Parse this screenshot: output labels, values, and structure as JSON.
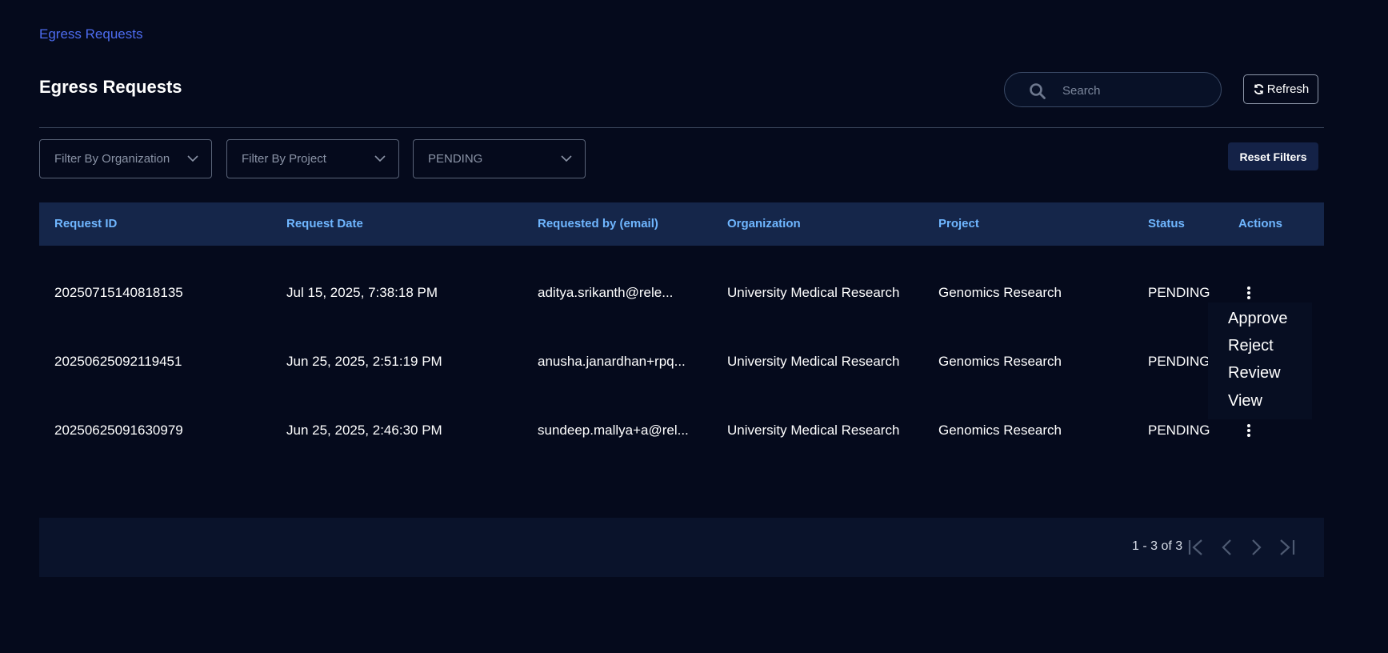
{
  "breadcrumb": {
    "label": "Egress Requests"
  },
  "page": {
    "title": "Egress Requests"
  },
  "search": {
    "placeholder": "Search",
    "value": ""
  },
  "toolbar": {
    "refresh_label": "Refresh",
    "reset_filters_label": "Reset Filters"
  },
  "filters": {
    "organization": "Filter By Organization",
    "project": "Filter By Project",
    "status": "PENDING"
  },
  "table": {
    "columns": [
      "Request ID",
      "Request Date",
      "Requested by (email)",
      "Organization",
      "Project",
      "Status",
      "Actions"
    ],
    "rows": [
      {
        "id": "20250715140818135",
        "date": "Jul 15, 2025, 7:38:18 PM",
        "email": "aditya.srikanth@rele...",
        "organization": "University Medical Research",
        "project": "Genomics Research",
        "status": "PENDING"
      },
      {
        "id": "20250625092119451",
        "date": "Jun 25, 2025, 2:51:19 PM",
        "email": "anusha.janardhan+rpq...",
        "organization": "University Medical Research",
        "project": "Genomics Research",
        "status": "PENDING"
      },
      {
        "id": "20250625091630979",
        "date": "Jun 25, 2025, 2:46:30 PM",
        "email": "sundeep.mallya+a@rel...",
        "organization": "University Medical Research",
        "project": "Genomics Research",
        "status": "PENDING"
      }
    ]
  },
  "actions_menu": {
    "items": [
      "Approve",
      "Reject",
      "Review",
      "View"
    ]
  },
  "pagination": {
    "info": "1 - 3 of 3"
  },
  "icons": {
    "search": "search-icon",
    "refresh": "refresh-icon",
    "dropdown": "chevron-down-icon",
    "kebab": "kebab-menu-icon",
    "first": "first-page-icon",
    "prev": "previous-page-icon",
    "next": "next-page-icon",
    "last": "last-page-icon"
  },
  "colors": {
    "background": "#050a1c",
    "header_bg": "#15264a",
    "header_text": "#6fb6ff",
    "link": "#4d6cf0",
    "reset_button_bg": "#142247"
  }
}
